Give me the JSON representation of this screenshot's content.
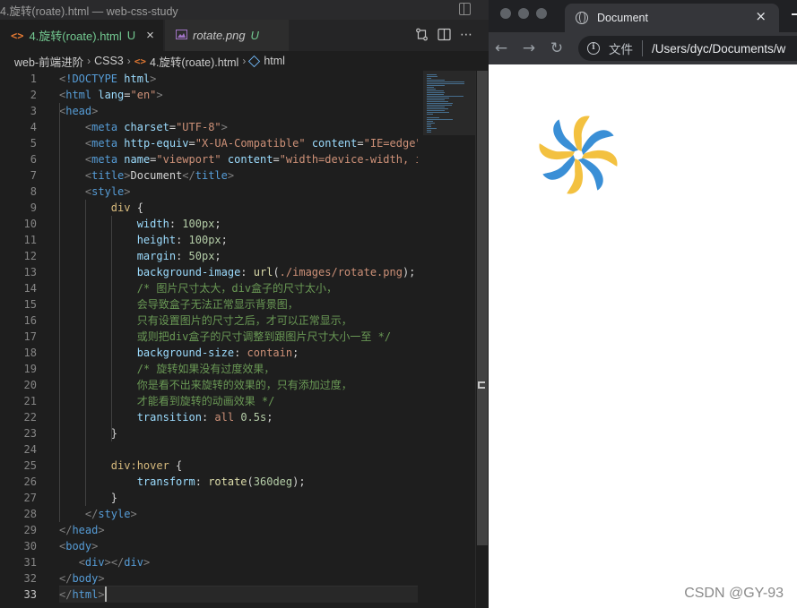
{
  "vscode": {
    "window_title": "4.旋转(roate).html — web-css-study",
    "tabs": [
      {
        "icon": "<>",
        "name": "4.旋转(roate).html",
        "badge": "U",
        "close": "×"
      },
      {
        "name": "rotate.png",
        "badge": "U"
      }
    ],
    "breadcrumb": {
      "folder1": "web-前端进阶",
      "folder2": "CSS3",
      "file": "4.旋转(roate).html",
      "symbol": "html"
    },
    "active_line": 33,
    "lines": [
      [
        [
          "tk-punct",
          "<"
        ],
        [
          "tk-tag",
          "!DOCTYPE "
        ],
        [
          "tk-attr",
          "html"
        ],
        [
          "tk-punct",
          ">"
        ]
      ],
      [
        [
          "tk-punct",
          "<"
        ],
        [
          "tk-tag",
          "html "
        ],
        [
          "tk-attr",
          "lang"
        ],
        [
          "tk-txt",
          "="
        ],
        [
          "tk-str",
          "\"en\""
        ],
        [
          "tk-punct",
          ">"
        ]
      ],
      [
        [
          "tk-punct",
          "<"
        ],
        [
          "tk-tag",
          "head"
        ],
        [
          "tk-punct",
          ">"
        ]
      ],
      [
        [
          "tk-txt",
          "    "
        ],
        [
          "tk-punct",
          "<"
        ],
        [
          "tk-tag",
          "meta "
        ],
        [
          "tk-attr",
          "charset"
        ],
        [
          "tk-txt",
          "="
        ],
        [
          "tk-str",
          "\"UTF-8\""
        ],
        [
          "tk-punct",
          ">"
        ]
      ],
      [
        [
          "tk-txt",
          "    "
        ],
        [
          "tk-punct",
          "<"
        ],
        [
          "tk-tag",
          "meta "
        ],
        [
          "tk-attr",
          "http-equiv"
        ],
        [
          "tk-txt",
          "="
        ],
        [
          "tk-str",
          "\"X-UA-Compatible\""
        ],
        [
          "tk-txt",
          " "
        ],
        [
          "tk-attr",
          "content"
        ],
        [
          "tk-txt",
          "="
        ],
        [
          "tk-str",
          "\"IE=edge\""
        ]
      ],
      [
        [
          "tk-txt",
          "    "
        ],
        [
          "tk-punct",
          "<"
        ],
        [
          "tk-tag",
          "meta "
        ],
        [
          "tk-attr",
          "name"
        ],
        [
          "tk-txt",
          "="
        ],
        [
          "tk-str",
          "\"viewport\""
        ],
        [
          "tk-txt",
          " "
        ],
        [
          "tk-attr",
          "content"
        ],
        [
          "tk-txt",
          "="
        ],
        [
          "tk-str",
          "\"width=device-width, i"
        ]
      ],
      [
        [
          "tk-txt",
          "    "
        ],
        [
          "tk-punct",
          "<"
        ],
        [
          "tk-tag",
          "title"
        ],
        [
          "tk-punct",
          ">"
        ],
        [
          "tk-txt",
          "Document"
        ],
        [
          "tk-punct",
          "</"
        ],
        [
          "tk-tag",
          "title"
        ],
        [
          "tk-punct",
          ">"
        ]
      ],
      [
        [
          "tk-txt",
          "    "
        ],
        [
          "tk-punct",
          "<"
        ],
        [
          "tk-tag",
          "style"
        ],
        [
          "tk-punct",
          ">"
        ]
      ],
      [
        [
          "tk-txt",
          "        "
        ],
        [
          "tk-sel",
          "div"
        ],
        [
          "tk-brace",
          " {"
        ]
      ],
      [
        [
          "tk-txt",
          "            "
        ],
        [
          "tk-prop",
          "width"
        ],
        [
          "tk-txt",
          ": "
        ],
        [
          "tk-num",
          "100px"
        ],
        [
          "tk-txt",
          ";"
        ]
      ],
      [
        [
          "tk-txt",
          "            "
        ],
        [
          "tk-prop",
          "height"
        ],
        [
          "tk-txt",
          ": "
        ],
        [
          "tk-num",
          "100px"
        ],
        [
          "tk-txt",
          ";"
        ]
      ],
      [
        [
          "tk-txt",
          "            "
        ],
        [
          "tk-prop",
          "margin"
        ],
        [
          "tk-txt",
          ": "
        ],
        [
          "tk-num",
          "50px"
        ],
        [
          "tk-txt",
          ";"
        ]
      ],
      [
        [
          "tk-txt",
          "            "
        ],
        [
          "tk-prop",
          "background-image"
        ],
        [
          "tk-txt",
          ": "
        ],
        [
          "tk-fn",
          "url"
        ],
        [
          "tk-txt",
          "("
        ],
        [
          "tk-val",
          "./images/rotate.png"
        ],
        [
          "tk-txt",
          ");"
        ]
      ],
      [
        [
          "tk-txt",
          "            "
        ],
        [
          "tk-com",
          "/* 图片尺寸太大，div盒子的尺寸太小，"
        ]
      ],
      [
        [
          "tk-txt",
          "            "
        ],
        [
          "tk-com",
          "会导致盒子无法正常显示背景图，"
        ]
      ],
      [
        [
          "tk-txt",
          "            "
        ],
        [
          "tk-com",
          "只有设置图片的尺寸之后，才可以正常显示，"
        ]
      ],
      [
        [
          "tk-txt",
          "            "
        ],
        [
          "tk-com",
          "或则把div盒子的尺寸调整到跟图片尺寸大小一至 */"
        ]
      ],
      [
        [
          "tk-txt",
          "            "
        ],
        [
          "tk-prop",
          "background-size"
        ],
        [
          "tk-txt",
          ": "
        ],
        [
          "tk-val",
          "contain"
        ],
        [
          "tk-txt",
          ";"
        ]
      ],
      [
        [
          "tk-txt",
          "            "
        ],
        [
          "tk-com",
          "/* 旋转如果没有过度效果，"
        ]
      ],
      [
        [
          "tk-txt",
          "            "
        ],
        [
          "tk-com",
          "你是看不出来旋转的效果的，只有添加过度，"
        ]
      ],
      [
        [
          "tk-txt",
          "            "
        ],
        [
          "tk-com",
          "才能看到旋转的动画效果 */"
        ]
      ],
      [
        [
          "tk-txt",
          "            "
        ],
        [
          "tk-prop",
          "transition"
        ],
        [
          "tk-txt",
          ": "
        ],
        [
          "tk-val",
          "all "
        ],
        [
          "tk-num",
          "0.5s"
        ],
        [
          "tk-txt",
          ";"
        ]
      ],
      [
        [
          "tk-txt",
          "        "
        ],
        [
          "tk-brace",
          "}"
        ]
      ],
      [
        [
          "tk-txt",
          ""
        ]
      ],
      [
        [
          "tk-txt",
          "        "
        ],
        [
          "tk-sel",
          "div:hover"
        ],
        [
          "tk-brace",
          " {"
        ]
      ],
      [
        [
          "tk-txt",
          "            "
        ],
        [
          "tk-prop",
          "transform"
        ],
        [
          "tk-txt",
          ": "
        ],
        [
          "tk-fn",
          "rotate"
        ],
        [
          "tk-txt",
          "("
        ],
        [
          "tk-num",
          "360deg"
        ],
        [
          "tk-txt",
          ");"
        ]
      ],
      [
        [
          "tk-txt",
          "        "
        ],
        [
          "tk-brace",
          "}"
        ]
      ],
      [
        [
          "tk-txt",
          "    "
        ],
        [
          "tk-punct",
          "</"
        ],
        [
          "tk-tag",
          "style"
        ],
        [
          "tk-punct",
          ">"
        ]
      ],
      [
        [
          "tk-punct",
          "</"
        ],
        [
          "tk-tag",
          "head"
        ],
        [
          "tk-punct",
          ">"
        ]
      ],
      [
        [
          "tk-punct",
          "<"
        ],
        [
          "tk-tag",
          "body"
        ],
        [
          "tk-punct",
          ">"
        ]
      ],
      [
        [
          "tk-txt",
          "   "
        ],
        [
          "tk-punct",
          "<"
        ],
        [
          "tk-tag",
          "div"
        ],
        [
          "tk-punct",
          "></"
        ],
        [
          "tk-tag",
          "div"
        ],
        [
          "tk-punct",
          ">"
        ]
      ],
      [
        [
          "tk-punct",
          "</"
        ],
        [
          "tk-tag",
          "body"
        ],
        [
          "tk-punct",
          ">"
        ]
      ],
      [
        [
          "tk-punct",
          "</"
        ],
        [
          "tk-tag",
          "html"
        ],
        [
          "tk-punct",
          ">"
        ]
      ]
    ]
  },
  "browser": {
    "tab_title": "Document",
    "tab_close": "×",
    "omnibox_label": "文件",
    "url": "/Users/dyc/Documents/w",
    "image_icon": "pinwheel-image",
    "watermark": "CSDN @GY-93"
  },
  "colors": {
    "editor_bg": "#1e1e1e",
    "untracked_green": "#73c991",
    "html_icon_orange": "#e37933",
    "pinwheel_blue": "#3a8fd6",
    "pinwheel_yellow": "#f3c140"
  }
}
